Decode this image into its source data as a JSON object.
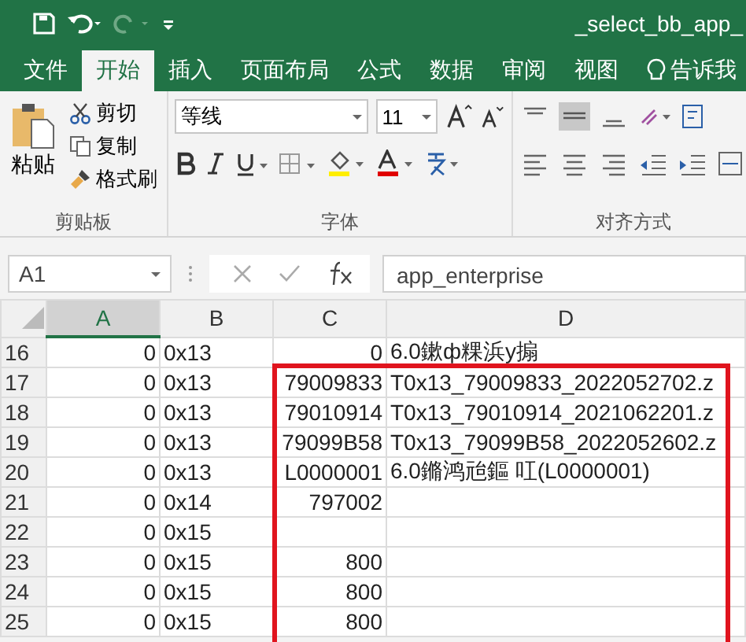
{
  "title_bar": {
    "title": "_select_bb_app_"
  },
  "tabs": [
    {
      "label": "文件",
      "selected": false
    },
    {
      "label": "开始",
      "selected": true
    },
    {
      "label": "插入",
      "selected": false
    },
    {
      "label": "页面布局",
      "selected": false
    },
    {
      "label": "公式",
      "selected": false
    },
    {
      "label": "数据",
      "selected": false
    },
    {
      "label": "审阅",
      "selected": false
    },
    {
      "label": "视图",
      "selected": false
    }
  ],
  "tell_me": "告诉我",
  "ribbon": {
    "clipboard": {
      "paste": "粘贴",
      "cut": "剪切",
      "copy": "复制",
      "format_painter": "格式刷",
      "group": "剪贴板"
    },
    "font": {
      "name": "等线",
      "size": "11",
      "group": "字体"
    },
    "alignment": {
      "group": "对齐方式"
    }
  },
  "formula_bar": {
    "name_box": "A1",
    "formula": "app_enterprise"
  },
  "columns": [
    "A",
    "B",
    "C",
    "D"
  ],
  "rows": [
    {
      "number": "16",
      "cells": [
        "0",
        "0x13",
        "0",
        "6.0鏉ф粿浜у搧"
      ]
    },
    {
      "number": "17",
      "cells": [
        "0",
        "0x13",
        "79009833",
        "T0x13_79009833_2022052702.z"
      ]
    },
    {
      "number": "18",
      "cells": [
        "0",
        "0x13",
        "79010914",
        "T0x13_79010914_2021062201.z"
      ]
    },
    {
      "number": "19",
      "cells": [
        "0",
        "0x13",
        "79099B58",
        "T0x13_79099B58_2022052602.z"
      ]
    },
    {
      "number": "20",
      "cells": [
        "0",
        "0x13",
        "L0000001",
        "6.0鏅鸿兘鏂    叿(L0000001)"
      ]
    },
    {
      "number": "21",
      "cells": [
        "0",
        "0x14",
        "797002",
        ""
      ]
    },
    {
      "number": "22",
      "cells": [
        "0",
        "0x15",
        "",
        ""
      ]
    },
    {
      "number": "23",
      "cells": [
        "0",
        "0x15",
        "800",
        ""
      ]
    },
    {
      "number": "24",
      "cells": [
        "0",
        "0x15",
        "800",
        ""
      ]
    },
    {
      "number": "25",
      "cells": [
        "0",
        "0x15",
        "800",
        ""
      ]
    }
  ]
}
